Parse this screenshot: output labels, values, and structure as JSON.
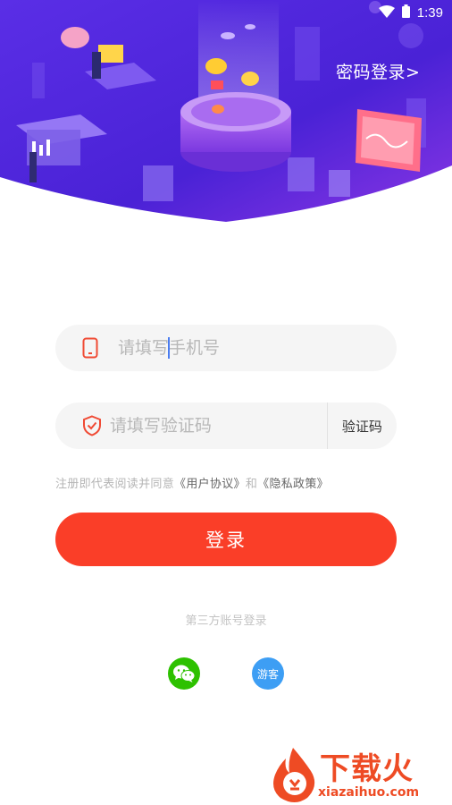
{
  "status_bar": {
    "time": "1:39"
  },
  "header": {
    "password_login_label": "密码登录>"
  },
  "form": {
    "phone_placeholder": "请填写手机号",
    "code_placeholder": "请填写验证码",
    "get_code_label": "验证码"
  },
  "agreement": {
    "prefix": "注册即代表阅读并同意",
    "user_agreement": "《用户协议》",
    "conjunction": "和",
    "privacy_policy": "《隐私政策》"
  },
  "login_button_label": "登录",
  "third_party": {
    "title": "第三方账号登录",
    "guest_label": "游客"
  },
  "watermark": {
    "brand": "下载火",
    "url": "xiazaihuo.com"
  },
  "colors": {
    "accent": "#fa3e28",
    "hero_start": "#4a1fd8",
    "hero_end": "#8d2ee0",
    "wechat": "#2dc100",
    "guest": "#3d9ef4"
  }
}
